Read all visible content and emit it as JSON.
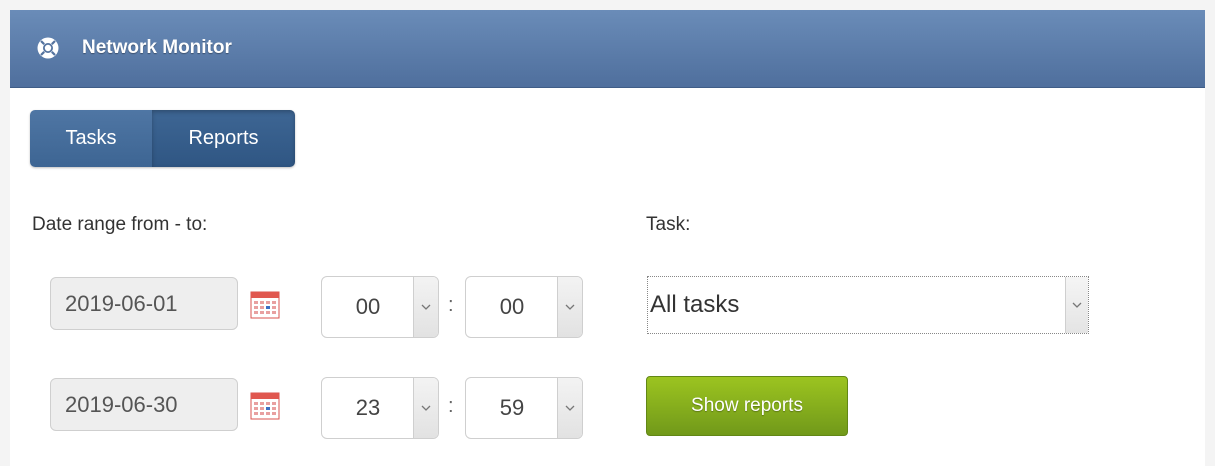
{
  "header": {
    "title": "Network Monitor",
    "icon": "lifebuoy-icon"
  },
  "tabs": [
    {
      "label": "Tasks",
      "active": false
    },
    {
      "label": "Reports",
      "active": true
    }
  ],
  "filters": {
    "date_range_label": "Date range from - to:",
    "task_label": "Task:",
    "from": {
      "date": "2019-06-01",
      "hour": "00",
      "minute": "00",
      "separator": ":"
    },
    "to": {
      "date": "2019-06-30",
      "hour": "23",
      "minute": "59",
      "separator": ":"
    },
    "task_value": "All tasks",
    "show_button_label": "Show reports"
  },
  "colors": {
    "header_bg": "#5b7eab",
    "tab_bg": "#3e6694",
    "button_bg": "#86b01d"
  }
}
